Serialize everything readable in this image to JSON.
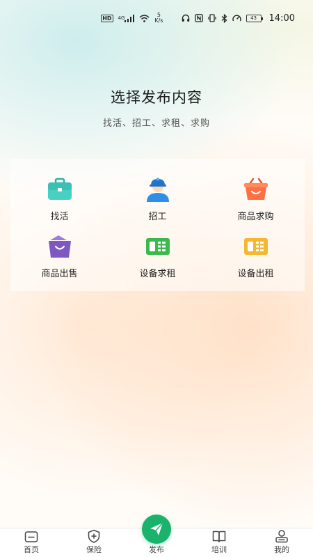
{
  "status_bar": {
    "hd": "HD",
    "network": "4G",
    "speed_value": "5",
    "speed_unit": "K/s",
    "battery": "43",
    "time": "14:00"
  },
  "page": {
    "title": "选择发布内容",
    "subtitle": "找活、招工、求租、求购"
  },
  "options": [
    {
      "label": "找活",
      "icon": "briefcase-icon",
      "color": "#3cc9bd"
    },
    {
      "label": "招工",
      "icon": "worker-icon",
      "color": "#2f8fe6"
    },
    {
      "label": "商品求购",
      "icon": "shopping-basket-icon",
      "color": "#ff7043"
    },
    {
      "label": "商品出售",
      "icon": "shopping-bag-icon",
      "color": "#7e57c2"
    },
    {
      "label": "设备求租",
      "icon": "equipment-card-icon",
      "color": "#3cb94d"
    },
    {
      "label": "设备出租",
      "icon": "equipment-card-icon",
      "color": "#f5b730"
    }
  ],
  "bottom_nav": [
    {
      "label": "首页",
      "icon": "home-icon"
    },
    {
      "label": "保险",
      "icon": "shield-icon"
    },
    {
      "label": "发布",
      "icon": "send-icon"
    },
    {
      "label": "培训",
      "icon": "book-icon"
    },
    {
      "label": "我的",
      "icon": "user-icon"
    }
  ],
  "colors": {
    "accent": "#19b36b"
  }
}
